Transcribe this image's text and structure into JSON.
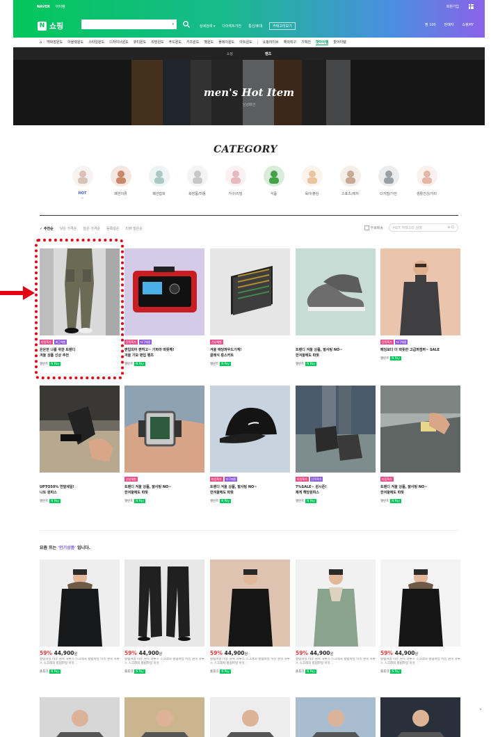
{
  "top": {
    "naver": "NAVER",
    "service": "아이템",
    "login_text": "회원가입",
    "logo_label": "쇼핑",
    "search_value": "",
    "header_links": [
      "상세검색 ▾",
      "다이렉트가전",
      "통신/휴대",
      "카테고리보기"
    ],
    "header_right": [
      "찜 100",
      "판매자",
      "쇼핑MY"
    ]
  },
  "category_nav": [
    "백화점윈도",
    "아울렛윈도",
    "스타일윈도",
    "디자이너윈도",
    "뷰티윈도",
    "리빙윈도",
    "푸드윈도",
    "키즈윈도",
    "펫윈도",
    "플레이윈도",
    "아트윈도",
    "쇼핑라이브",
    "해외직구",
    "기획전",
    "핫아이템",
    "핫아이템"
  ],
  "banner": {
    "tabs": [
      "쇼핑",
      "맨즈"
    ],
    "title": "men's Hot Item",
    "subtitle": "남성패션"
  },
  "category_title": "CATEGORY",
  "categories": [
    {
      "label": "HOT",
      "active": true,
      "color": "#d8c2b8"
    },
    {
      "label": "패션의류",
      "active": false,
      "color": "#c98968"
    },
    {
      "label": "패션잡화",
      "active": false,
      "color": "#aac8c4"
    },
    {
      "label": "화장품/미용",
      "active": false,
      "color": "#c7c7c9"
    },
    {
      "label": "가구/리빙",
      "active": false,
      "color": "#e7b9c0"
    },
    {
      "label": "식품",
      "active": false,
      "color": "#43a147"
    },
    {
      "label": "육아/출산",
      "active": false,
      "color": "#e9c5a0"
    },
    {
      "label": "스포츠/레저",
      "active": false,
      "color": "#c8a895"
    },
    {
      "label": "디지털/가전",
      "active": false,
      "color": "#9aa0a6"
    },
    {
      "label": "생활건강/기타",
      "active": false,
      "color": "#e3b8a6"
    }
  ],
  "sort": {
    "options": [
      "추천순",
      "낮은 가격순",
      "높은 가격순",
      "등록일순",
      "리뷰 많은순"
    ],
    "free_shipping": "무료배송",
    "search_placeholder": "HOT 카테고리 검색"
  },
  "products_row1": [
    {
      "badges": [
        {
          "text": "타임특가",
          "color": "pink"
        },
        {
          "text": "최근체험",
          "color": "purple"
        }
      ],
      "name": "은은한 나를 위한 트렌디\n겨울 상품 신상 추천",
      "seller": "앨런트",
      "npay": "N Pay"
    },
    {
      "badges": [
        {
          "text": "단독특가",
          "color": "pink"
        },
        {
          "text": "타구매중",
          "color": "purple"
        }
      ],
      "name": "편입되어 편하고~ 기파라 따뜻해!\n겨울 기모 편입 팬츠",
      "seller": "앨런트",
      "npay": "N Pay"
    },
    {
      "badges": [
        {
          "text": "신상체험",
          "color": "pink"
        }
      ],
      "name": "겨울 애딩파우드기계!\n클래식 롱스커트",
      "seller": "앨런트",
      "npay": "N Pay"
    },
    {
      "badges": [],
      "name": "트렌디 겨울 상품, 발사팅 NO~\n한겨울에도 따뜻",
      "seller": "앨런트",
      "npay": "N Pay"
    },
    {
      "badges": [
        {
          "text": "단독특가",
          "color": "pink"
        },
        {
          "text": "타구매중",
          "color": "purple"
        }
      ],
      "name": "패딩보다 더 따뜻한 고급퍼점퍼~ SALE",
      "seller": "앨런트",
      "npay": "N Pay"
    }
  ],
  "products_row2": [
    {
      "badges": [],
      "name": "UPTO50% 연말세일!\n니트 원피스",
      "seller": "앨런트",
      "npay": "N Pay"
    },
    {
      "badges": [
        {
          "text": "신상체험",
          "color": "pink"
        }
      ],
      "name": "트렌디 겨울 상품, 발사팅 NO~\n한겨울에도 따뜻",
      "seller": "앨런트",
      "npay": "N Pay"
    },
    {
      "badges": [
        {
          "text": "타임특가",
          "color": "pink"
        },
        {
          "text": "타구매중",
          "color": "purple"
        }
      ],
      "name": "트렌디 겨울 상품, 발사팅 NO~\n한겨울에도 따뜻",
      "seller": "앨런트",
      "npay": "N Pay"
    },
    {
      "badges": [
        {
          "text": "타임특가",
          "color": "pink"
        },
        {
          "text": "단독특가",
          "color": "purple"
        }
      ],
      "name": "7%SALE~ 윈시즌!\n제게 해당원피스",
      "seller": "앨런트",
      "npay": "N Pay"
    },
    {
      "badges": [
        {
          "text": "타임특가",
          "color": "pink"
        }
      ],
      "name": "트렌디 겨울 상품, 발사팅 NO~\n한겨울에도 따뜻",
      "seller": "앨런트",
      "npay": "N Pay"
    }
  ],
  "section2": {
    "title_prefix": "요즘 뜨는",
    "title_highlight": "'인기상품'",
    "title_suffix": "입니다."
  },
  "popular": [
    {
      "discount": "59%",
      "price": "44,900",
      "won": "원",
      "desc": "컬럼파일 이유 원목 하루스 스크래처 컬럼파일 이유 원목 하루스 스크래처 컬럼파일 이유 ..",
      "seller": "즐후크"
    },
    {
      "discount": "59%",
      "price": "44,900",
      "won": "원",
      "desc": "컬럼파일 이유 원목 하루스 스크래처 컬럼파일 이유 원목 하루스 스크래처 컬럼파일 이유 ..",
      "seller": "즐후크"
    },
    {
      "discount": "59%",
      "price": "44,900",
      "won": "원",
      "desc": "컬럼파일 이유 원목 하루스 스크래처 컬럼파일 이유 원목 하루스 스크래처 컬럼파일 이유 ..",
      "seller": "즐후크"
    },
    {
      "discount": "59%",
      "price": "44,900",
      "won": "원",
      "desc": "컬럼파일 이유 원목 하루스 스크래처 컬럼파일 이유 원목 하루스 스크래처 컬럼파일 이유 ..",
      "seller": "즐후크"
    },
    {
      "discount": "59%",
      "price": "44,900",
      "won": "원",
      "desc": "컬럼파일 이유 원목 하루스 스크래처 컬럼파일 이유 원목 하루스 스크래처 컬럼파일 이유 ..",
      "seller": "즐후크"
    }
  ],
  "colors": {
    "brand_green": "#03c75a",
    "highlight_red": "#e60012",
    "accent_purple": "#7b5be0",
    "sale_red": "#e83838"
  }
}
